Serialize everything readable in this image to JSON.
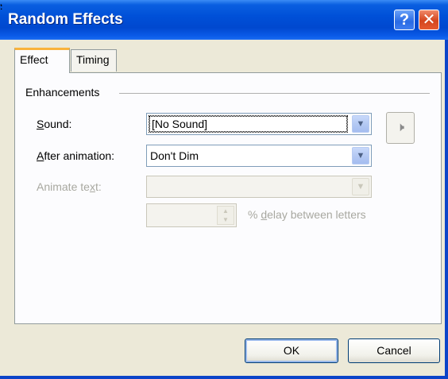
{
  "window": {
    "title": "Random Effects",
    "help_glyph": "?",
    "close_glyph": "✕"
  },
  "tabs": [
    {
      "label": "Effect",
      "selected": true
    },
    {
      "label": "Timing",
      "selected": false
    }
  ],
  "enhancements": {
    "group_label": "Enhancements",
    "sound": {
      "label_prefix": "S",
      "label_rest": "ound:",
      "value": "[No Sound]",
      "icon": "speaker-icon"
    },
    "after_animation": {
      "label_prefix": "A",
      "label_rest": "fter animation:",
      "value": "Don't Dim"
    },
    "animate_text": {
      "label_prefix": "Animate te",
      "label_mid": "x",
      "label_rest": "t:",
      "value": "",
      "enabled": false
    },
    "delay": {
      "value": "",
      "suffix_prefix": "% ",
      "suffix_ul": "d",
      "suffix_rest": "elay between letters",
      "enabled": false
    }
  },
  "buttons": {
    "ok": "OK",
    "cancel": "Cancel"
  },
  "colors": {
    "titlebar": "#0050d8",
    "tab_accent": "#f9b33c",
    "dialog_bg": "#ece9d8"
  }
}
